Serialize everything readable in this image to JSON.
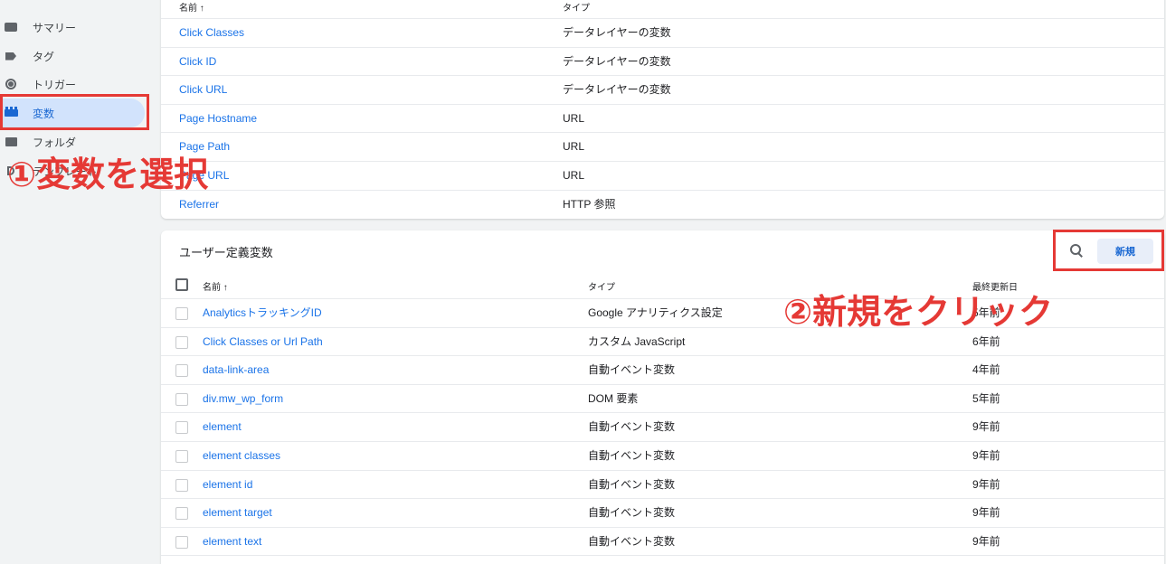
{
  "sidebar": {
    "items": [
      {
        "label": "サマリー",
        "icon": "summary-icon"
      },
      {
        "label": "タグ",
        "icon": "tag-icon"
      },
      {
        "label": "トリガー",
        "icon": "trigger-icon"
      },
      {
        "label": "変数",
        "icon": "variable-icon",
        "active": true
      },
      {
        "label": "フォルダ",
        "icon": "folder-icon"
      },
      {
        "label": "テンプレート",
        "icon": "template-icon"
      }
    ]
  },
  "builtin": {
    "col_name": "名前 ↑",
    "col_type": "タイプ",
    "rows": [
      {
        "name": "Click Classes",
        "type": "データレイヤーの変数"
      },
      {
        "name": "Click ID",
        "type": "データレイヤーの変数"
      },
      {
        "name": "Click URL",
        "type": "データレイヤーの変数"
      },
      {
        "name": "Page Hostname",
        "type": "URL"
      },
      {
        "name": "Page Path",
        "type": "URL"
      },
      {
        "name": "Page URL",
        "type": "URL"
      },
      {
        "name": "Referrer",
        "type": "HTTP 参照"
      }
    ]
  },
  "user_defined": {
    "title": "ユーザー定義変数",
    "new_button": "新規",
    "col_name": "名前 ↑",
    "col_type": "タイプ",
    "col_updated": "最終更新日",
    "rows": [
      {
        "name": "AnalyticsトラッキングID",
        "type": "Google アナリティクス設定",
        "updated": "5年前"
      },
      {
        "name": "Click Classes or Url Path",
        "type": "カスタム JavaScript",
        "updated": "6年前"
      },
      {
        "name": "data-link-area",
        "type": "自動イベント変数",
        "updated": "4年前"
      },
      {
        "name": "div.mw_wp_form",
        "type": "DOM 要素",
        "updated": "5年前"
      },
      {
        "name": "element",
        "type": "自動イベント変数",
        "updated": "9年前"
      },
      {
        "name": "element classes",
        "type": "自動イベント変数",
        "updated": "9年前"
      },
      {
        "name": "element id",
        "type": "自動イベント変数",
        "updated": "9年前"
      },
      {
        "name": "element target",
        "type": "自動イベント変数",
        "updated": "9年前"
      },
      {
        "name": "element text",
        "type": "自動イベント変数",
        "updated": "9年前"
      }
    ]
  },
  "annotations": {
    "step1": "①変数を選択",
    "step2": "②新規をクリック",
    "color": "#e53935"
  }
}
